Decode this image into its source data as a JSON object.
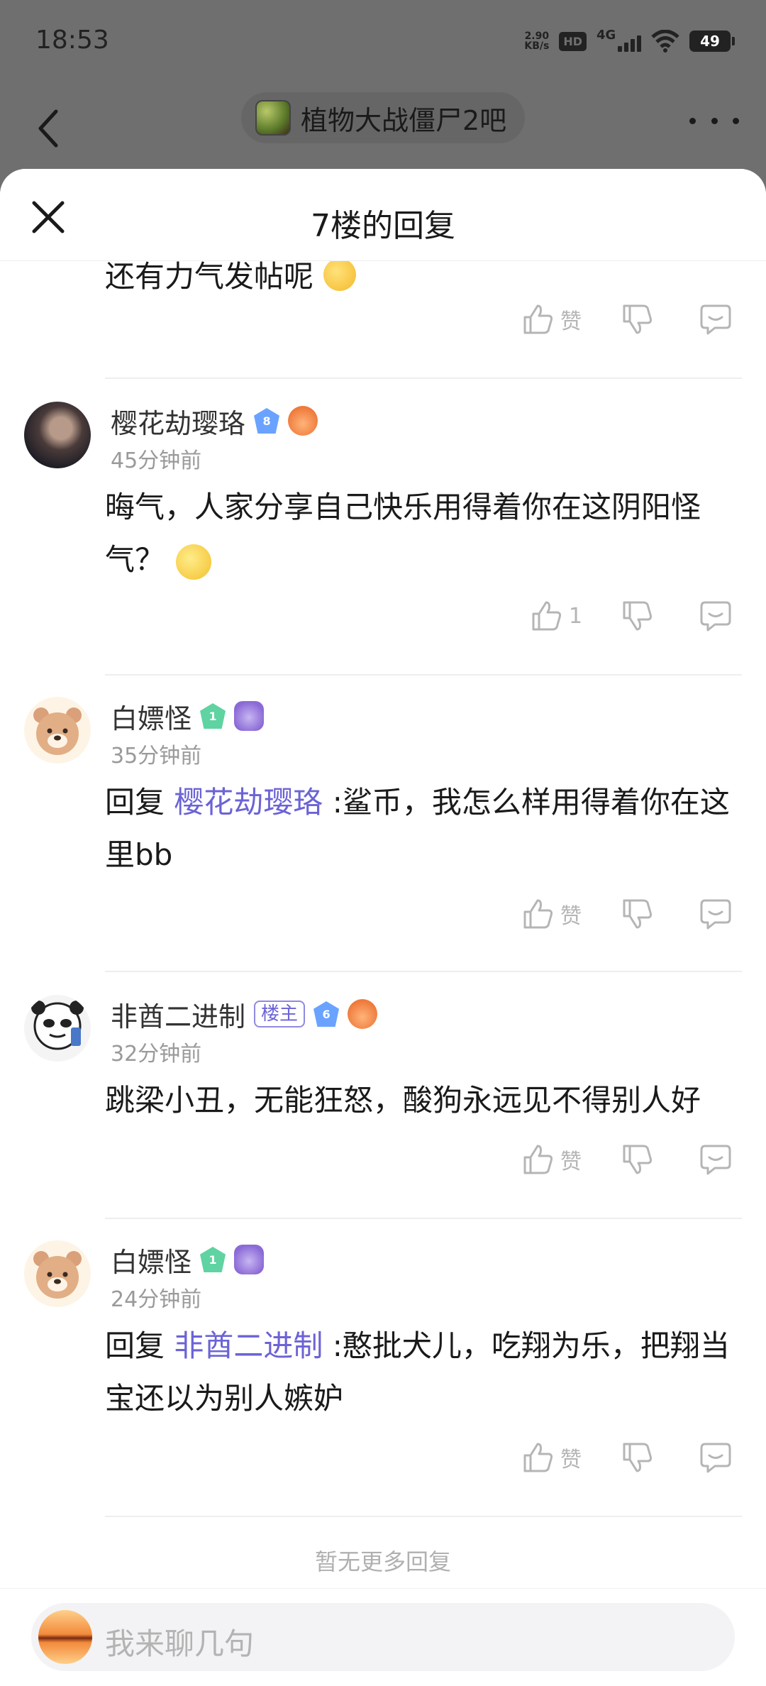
{
  "status_bar": {
    "time": "18:53",
    "net_speed_value": "2.90",
    "net_speed_unit": "KB/s",
    "hd": "HD",
    "network": "4G",
    "battery": "49"
  },
  "nav": {
    "forum_name": "植物大战僵尸2吧"
  },
  "sheet": {
    "title": "7楼的回复",
    "partial_text": "还有力气发帖呢"
  },
  "actions": {
    "like_label": "赞",
    "like_count_1": "1"
  },
  "comments": [
    {
      "username": "樱花劫璎珞",
      "level": "8",
      "time": "45分钟前",
      "text": "晦气，人家分享自己快乐用得着你在这阴阳怪气？"
    },
    {
      "username": "白嫖怪",
      "level": "1",
      "time": "35分钟前",
      "reply_prefix": "回复 ",
      "reply_to": "樱花劫璎珞",
      "text": " :鲨币，我怎么样用得着你在这里bb"
    },
    {
      "username": "非酋二进制",
      "owner_tag": "楼主",
      "level": "6",
      "time": "32分钟前",
      "text": "跳梁小丑，无能狂怒，酸狗永远见不得别人好"
    },
    {
      "username": "白嫖怪",
      "level": "1",
      "time": "24分钟前",
      "reply_prefix": "回复 ",
      "reply_to": "非酋二进制",
      "text": " :憨批犬儿，吃翔为乐，把翔当宝还以为别人嫉妒"
    }
  ],
  "footer": {
    "no_more": "暂无更多回复",
    "input_placeholder": "我来聊几句"
  },
  "colors": {
    "accent": "#6b63d6",
    "muted": "#9a9a9a",
    "icon": "#b5b5b5",
    "dim_bg": "#6f6f6f"
  }
}
